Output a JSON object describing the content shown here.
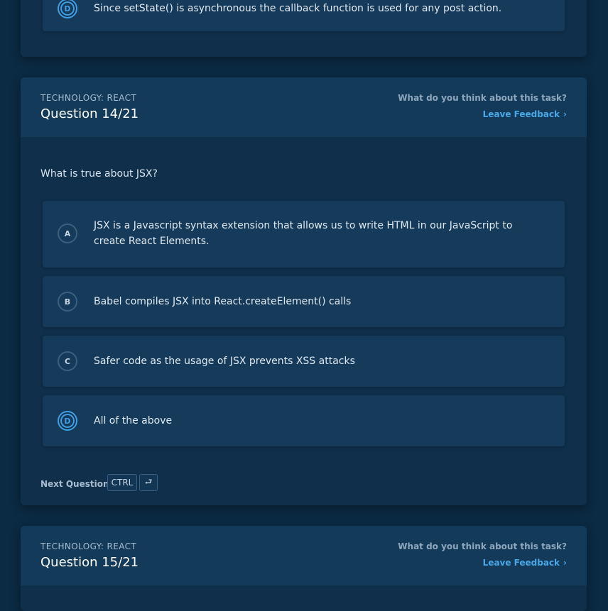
{
  "prev_question": {
    "option_d": {
      "letter": "D",
      "text": "Since setState() is asynchronous the callback function is used for any post action."
    }
  },
  "question14": {
    "technology": "TECHNOLOGY: REACT",
    "title": "Question 14/21",
    "think": "What do you think about this task?",
    "feedback": "Leave Feedback",
    "prompt": "What is true about JSX?",
    "options": [
      {
        "letter": "A",
        "text": "JSX is a Javascript syntax extension that allows us to write HTML in our JavaScript to create React Elements."
      },
      {
        "letter": "B",
        "text": "Babel compiles JSX into React.createElement() calls"
      },
      {
        "letter": "C",
        "text": "Safer code as the usage of JSX prevents XSS attacks"
      },
      {
        "letter": "D",
        "text": "All of the above"
      }
    ],
    "next_label": "Next Question",
    "key_ctrl": "CTRL",
    "key_enter": "⮐"
  },
  "question15": {
    "technology": "TECHNOLOGY: REACT",
    "title": "Question 15/21",
    "think": "What do you think about this task?",
    "feedback": "Leave Feedback"
  },
  "icons": {
    "chevron": "›"
  }
}
